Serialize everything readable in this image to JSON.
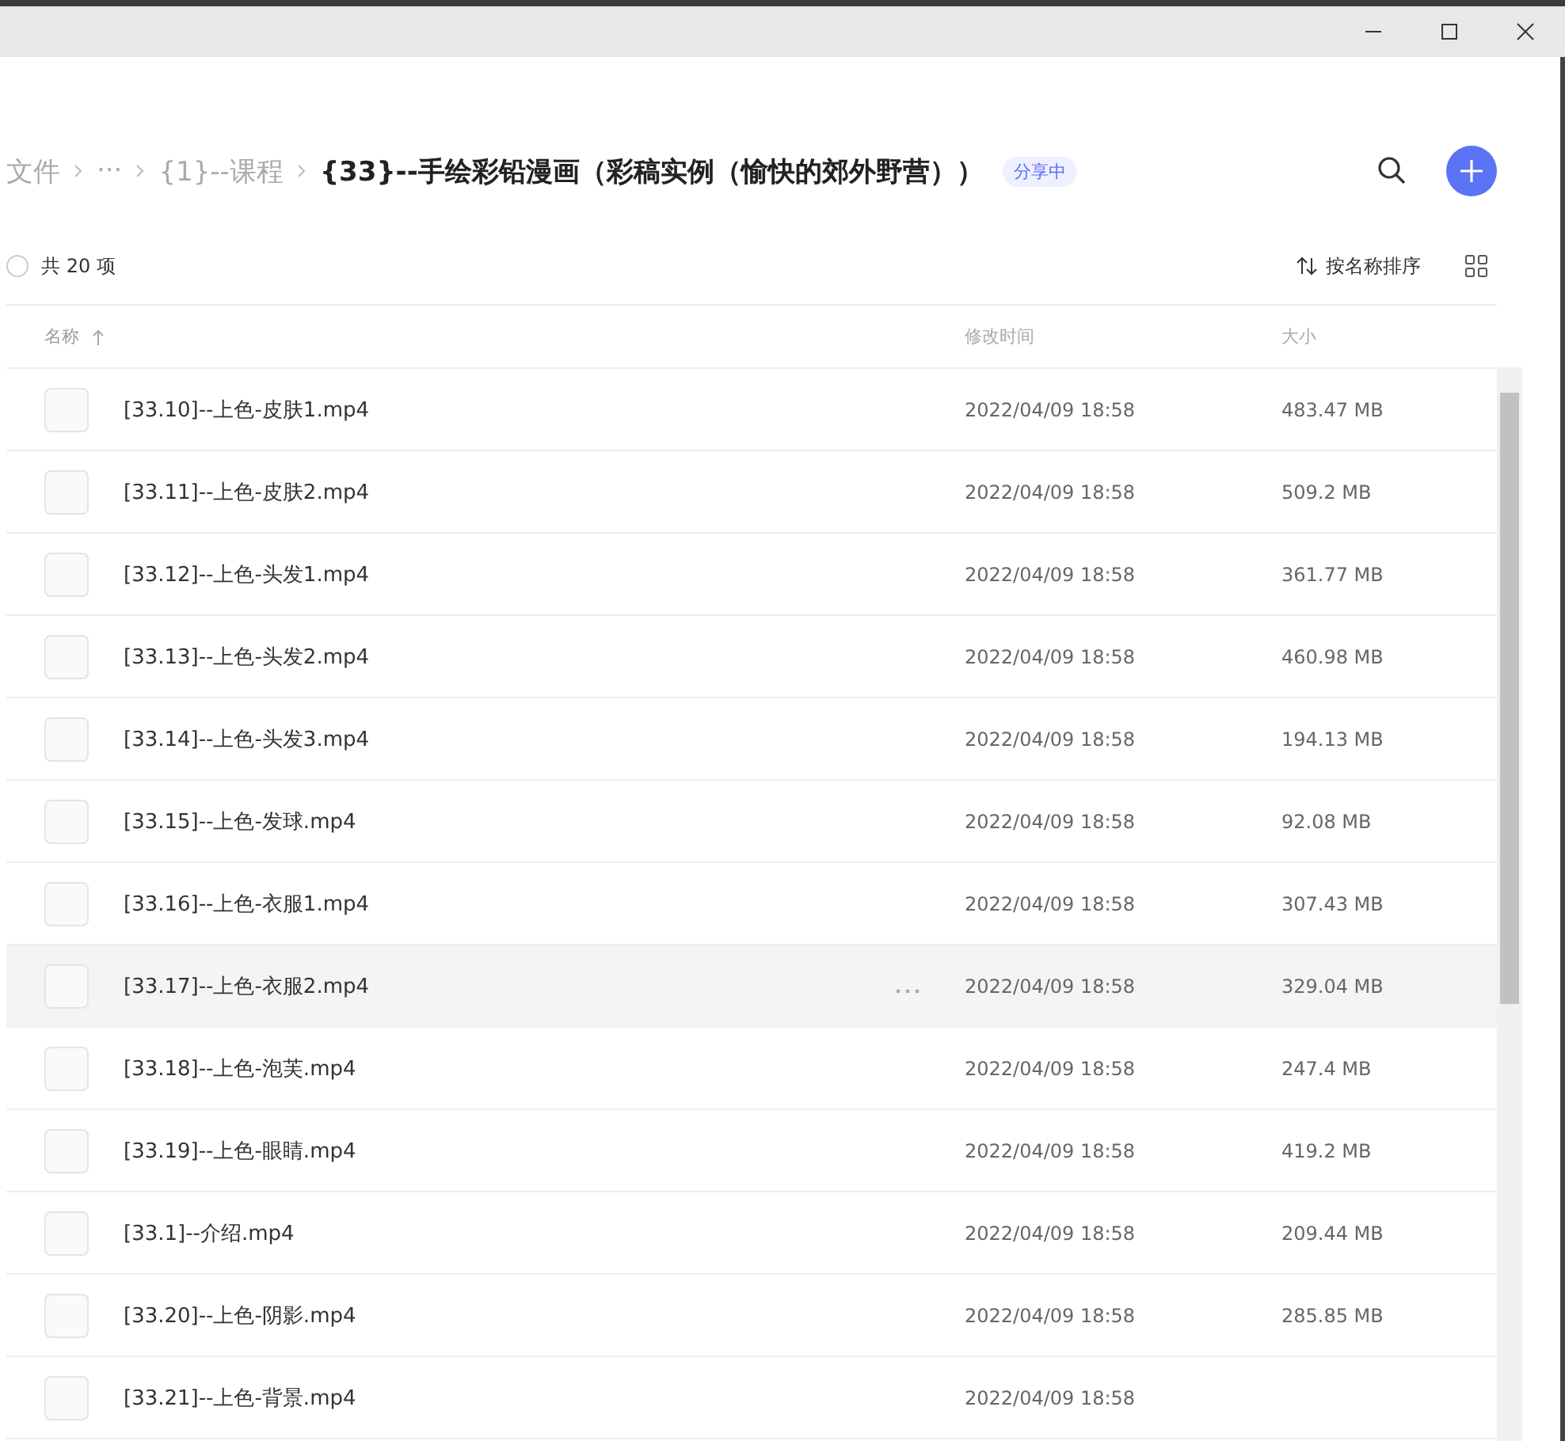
{
  "breadcrumb": [
    {
      "label": "文件",
      "kind": "link"
    },
    {
      "label": "···",
      "kind": "link"
    },
    {
      "label": "{1}--课程",
      "kind": "link"
    },
    {
      "label": "{33}--手绘彩铅漫画（彩稿实例（愉快的郊外野营））",
      "kind": "current"
    }
  ],
  "share_badge": "分享中",
  "toolbar": {
    "select_all": {
      "checked": false
    },
    "count": "共 20 项",
    "sort": "按名称排序"
  },
  "table": {
    "columns": [
      {
        "label": "名称",
        "sorted": true
      },
      {
        "label": "修改时间",
        "sorted": false
      },
      {
        "label": "大小",
        "sorted": false
      }
    ],
    "rows": [
      {
        "name": "[33.10]--上色-皮肤1.mp4",
        "modified": "2022/04/09 18:58",
        "size": "483.47 MB",
        "hovered": false
      },
      {
        "name": "[33.11]--上色-皮肤2.mp4",
        "modified": "2022/04/09 18:58",
        "size": "509.2 MB",
        "hovered": false
      },
      {
        "name": "[33.12]--上色-头发1.mp4",
        "modified": "2022/04/09 18:58",
        "size": "361.77 MB",
        "hovered": false
      },
      {
        "name": "[33.13]--上色-头发2.mp4",
        "modified": "2022/04/09 18:58",
        "size": "460.98 MB",
        "hovered": false
      },
      {
        "name": "[33.14]--上色-头发3.mp4",
        "modified": "2022/04/09 18:58",
        "size": "194.13 MB",
        "hovered": false
      },
      {
        "name": "[33.15]--上色-发球.mp4",
        "modified": "2022/04/09 18:58",
        "size": "92.08 MB",
        "hovered": false
      },
      {
        "name": "[33.16]--上色-衣服1.mp4",
        "modified": "2022/04/09 18:58",
        "size": "307.43 MB",
        "hovered": false
      },
      {
        "name": "[33.17]--上色-衣服2.mp4",
        "modified": "2022/04/09 18:58",
        "size": "329.04 MB",
        "hovered": true
      },
      {
        "name": "[33.18]--上色-泡芙.mp4",
        "modified": "2022/04/09 18:58",
        "size": "247.4 MB",
        "hovered": false
      },
      {
        "name": "[33.19]--上色-眼睛.mp4",
        "modified": "2022/04/09 18:58",
        "size": "419.2 MB",
        "hovered": false
      },
      {
        "name": "[33.1]--介绍.mp4",
        "modified": "2022/04/09 18:58",
        "size": "209.44 MB",
        "hovered": false
      },
      {
        "name": "[33.20]--上色-阴影.mp4",
        "modified": "2022/04/09 18:58",
        "size": "285.85 MB",
        "hovered": false
      },
      {
        "name": "[33.21]--上色-背景.mp4",
        "modified": "2022/04/09 18:58",
        "hovered": false
      }
    ]
  }
}
